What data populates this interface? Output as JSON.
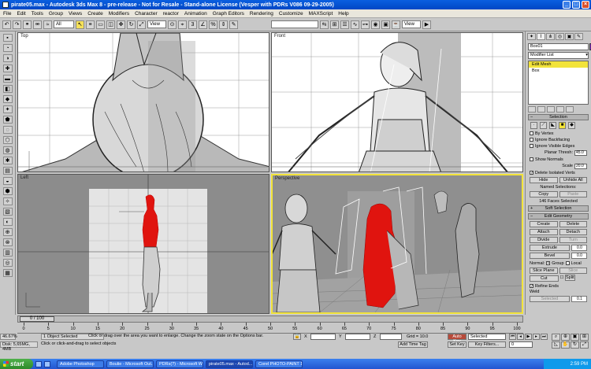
{
  "window": {
    "title": "pirate05.max - Autodesk 3ds Max 8 - pre-release - Not for Resale - Stand-alone License (Vesper with PDRs V086 09-29-2005)"
  },
  "menu": [
    "File",
    "Edit",
    "Tools",
    "Group",
    "Views",
    "Create",
    "Modifiers",
    "Character",
    "reactor",
    "Animation",
    "Graph Editors",
    "Rendering",
    "Customize",
    "MAXScript",
    "Help"
  ],
  "toolbar": {
    "selection_filter": "All",
    "ref_coord": "View",
    "ref_coord2": "View",
    "named_sel": ""
  },
  "viewports": {
    "top": "Top",
    "front": "Front",
    "left": "Left",
    "perspective": "Perspective"
  },
  "command_panel": {
    "object_name": "Box01",
    "modifier_list": "Modifier List",
    "stack": [
      "Edit Mesh",
      "Box"
    ],
    "selection": {
      "title": "Selection",
      "by_vertex": "By Vertex",
      "ignore_backfacing": "Ignore Backfacing",
      "ignore_visible_edges": "Ignore Visible Edges",
      "planar_thresh_label": "Planar Thresh:",
      "planar_thresh": "45.0",
      "show_normals": "Show Normals",
      "scale_label": "Scale",
      "scale": "20.0",
      "delete_isolated": "Delete Isolated Verts",
      "hide": "Hide",
      "unhide_all": "Unhide All",
      "named_selections": "Named Selections:",
      "copy": "Copy",
      "paste": "Paste",
      "faces_selected": "146 Faces Selected"
    },
    "soft_selection": "Soft Selection",
    "edit_geometry": {
      "title": "Edit Geometry",
      "create": "Create",
      "delete": "Delete",
      "attach": "Attach",
      "detach": "Detach",
      "divide": "Divide",
      "turn": "Turn",
      "extrude": "Extrude",
      "extrude_val": "0.0",
      "bevel": "Bevel",
      "bevel_val": "0.0",
      "normal": "Normal:",
      "group": "Group",
      "local": "Local",
      "slice_plane": "Slice Plane",
      "slice": "Slice",
      "cut": "Cut",
      "split": "Split",
      "refine_ends": "Refine Ends",
      "weld": "Weld",
      "selected": "Selected",
      "weld_val": "0.1"
    }
  },
  "timeline": {
    "frame_display": "0 / 100",
    "ticks": [
      "0",
      "5",
      "10",
      "15",
      "20",
      "25",
      "30",
      "35",
      "40",
      "45",
      "50",
      "55",
      "60",
      "65",
      "70",
      "75",
      "80",
      "85",
      "90",
      "95",
      "100"
    ]
  },
  "status": {
    "selection_count": "1 Object Selected",
    "prompt": "Click or click-and-drag to select objects",
    "hint": "Click or drag over the area you want to enlarge. Change the zoom state on the Options bar.",
    "x": "",
    "y": "",
    "z": "",
    "grid": "Grid = 10.0",
    "add_time_tag": "Add Time Tag",
    "auto_key": "Auto Key",
    "set_key": "Set Key",
    "selected": "Selected",
    "key_filters": "Key Filters...",
    "frame": "0",
    "mem1": "46.67%",
    "mem2": "Disk: 5,65MG, 4MB"
  },
  "taskbar": {
    "start": "start",
    "tasks": [
      "Adobe Photoshop",
      "Boulie - Microsoft Out...",
      "PDRs(?) - Microsoft W...",
      "pirate05.max - Autod...",
      "Corel PHOTO-PAINT 12"
    ],
    "clock": "2:59 PM"
  },
  "colors": {
    "selected_mesh": "#e0140f",
    "active_viewport_border": "#f2e33a",
    "object_swatch": "#7a2fb5"
  }
}
